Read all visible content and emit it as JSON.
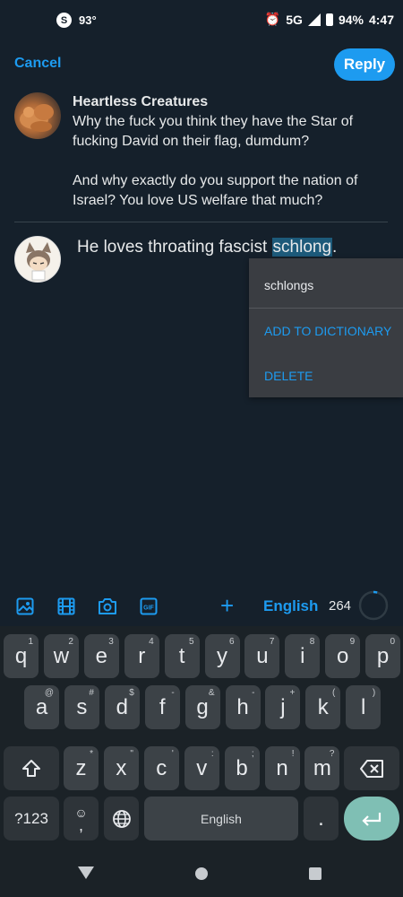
{
  "status": {
    "temperature": "93°",
    "network": "5G",
    "battery": "94%",
    "time": "4:47"
  },
  "header": {
    "cancel_label": "Cancel",
    "reply_label": "Reply"
  },
  "parent_tweet": {
    "author": "Heartless Creatures",
    "paragraph1": "Why the fuck you think they have the Star of fucking David on their flag, dumdum?",
    "paragraph2": "And why exactly do you support the nation of Israel? You love US welfare that much?"
  },
  "compose": {
    "text_before": "He loves throating fascist ",
    "selected_word": "schlong",
    "text_after": "."
  },
  "spell_menu": {
    "suggestion": "schlongs",
    "add_label": "ADD TO DICTIONARY",
    "delete_label": "DELETE"
  },
  "toolbar": {
    "language": "English",
    "char_count": "264",
    "icons": [
      "image-icon",
      "video-icon",
      "camera-icon",
      "gif-icon"
    ],
    "progress": 0.045
  },
  "keyboard": {
    "row1": [
      {
        "k": "q",
        "h": "1"
      },
      {
        "k": "w",
        "h": "2"
      },
      {
        "k": "e",
        "h": "3"
      },
      {
        "k": "r",
        "h": "4"
      },
      {
        "k": "t",
        "h": "5"
      },
      {
        "k": "y",
        "h": "6"
      },
      {
        "k": "u",
        "h": "7"
      },
      {
        "k": "i",
        "h": "8"
      },
      {
        "k": "o",
        "h": "9"
      },
      {
        "k": "p",
        "h": "0"
      }
    ],
    "row2": [
      {
        "k": "a",
        "h": "@"
      },
      {
        "k": "s",
        "h": "#"
      },
      {
        "k": "d",
        "h": "$"
      },
      {
        "k": "f",
        "h": "-"
      },
      {
        "k": "g",
        "h": "&"
      },
      {
        "k": "h",
        "h": "-"
      },
      {
        "k": "j",
        "h": "+"
      },
      {
        "k": "k",
        "h": "("
      },
      {
        "k": "l",
        "h": ")"
      }
    ],
    "row3": [
      {
        "k": "z",
        "h": "*"
      },
      {
        "k": "x",
        "h": "\""
      },
      {
        "k": "c",
        "h": "'"
      },
      {
        "k": "v",
        "h": ":"
      },
      {
        "k": "b",
        "h": ";"
      },
      {
        "k": "n",
        "h": "!"
      },
      {
        "k": "m",
        "h": "?"
      }
    ],
    "symbols_label": "?123",
    "emoji_label": "☺",
    "comma_label": ",",
    "space_label": "English",
    "period_label": ".",
    "shift_label": "⇧",
    "backspace_label": "⌫",
    "enter_label": "↵",
    "globe_label": "🌐"
  },
  "colors": {
    "accent": "#1d9bf0",
    "background": "#15202b"
  }
}
